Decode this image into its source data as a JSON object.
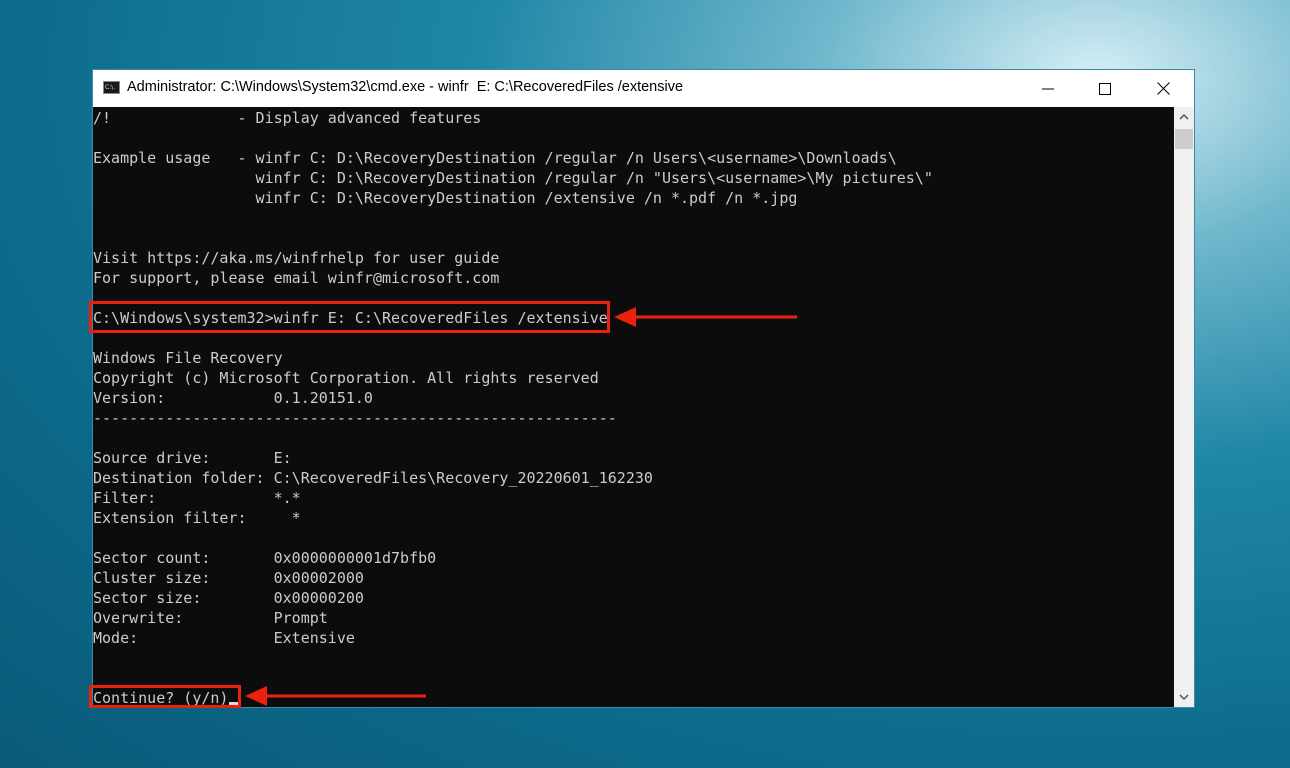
{
  "window": {
    "title": "Administrator: C:\\Windows\\System32\\cmd.exe - winfr  E: C:\\RecoveredFiles /extensive",
    "app_icon_text": "C:\\.",
    "controls": [
      "minimize",
      "maximize",
      "close"
    ]
  },
  "terminal": {
    "lines": [
      "/!              - Display advanced features",
      "",
      "Example usage   - winfr C: D:\\RecoveryDestination /regular /n Users\\<username>\\Downloads\\",
      "                  winfr C: D:\\RecoveryDestination /regular /n \"Users\\<username>\\My pictures\\\"",
      "                  winfr C: D:\\RecoveryDestination /extensive /n *.pdf /n *.jpg",
      "",
      "",
      "Visit https://aka.ms/winfrhelp for user guide",
      "For support, please email winfr@microsoft.com",
      "",
      "C:\\Windows\\system32>winfr E: C:\\RecoveredFiles /extensive",
      "",
      "Windows File Recovery",
      "Copyright (c) Microsoft Corporation. All rights reserved",
      "Version:            0.1.20151.0",
      "----------------------------------------------------------",
      "",
      "Source drive:       E:",
      "Destination folder: C:\\RecoveredFiles\\Recovery_20220601_162230",
      "Filter:             *.*",
      "Extension filter:     *",
      "",
      "Sector count:       0x0000000001d7bfb0",
      "Cluster size:       0x00002000",
      "Sector size:        0x00000200",
      "Overwrite:          Prompt",
      "Mode:               Extensive",
      "",
      "",
      "Continue? (y/n)"
    ]
  },
  "annotations": {
    "color": "#e8220f"
  }
}
